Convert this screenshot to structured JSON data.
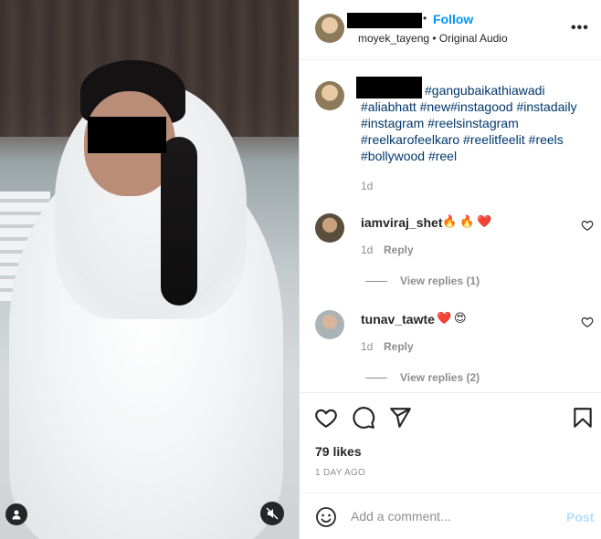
{
  "post": {
    "header": {
      "follow_label": "Follow",
      "dot": "•",
      "subtitle": "moyek_tayeng • Original Audio",
      "more_label": "•••"
    },
    "caption": {
      "text": "#gangubaikathiawadi #aliabhatt #new#instagood #instadaily #instagram #reelsinstagram #reelkarofeelkaro #reelitfeelit #reels #bollywood #reel",
      "age": "1d"
    },
    "comments": [
      {
        "username": "iamviraj_shet",
        "emoji": [
          "🔥",
          "🔥",
          "❤️"
        ],
        "age": "1d",
        "reply_label": "Reply",
        "view_replies_label": "View replies (1)"
      },
      {
        "username": "tunav_tawte",
        "emoji": [
          "❤️",
          "😍"
        ],
        "age": "1d",
        "reply_label": "Reply",
        "view_replies_label": "View replies (2)"
      }
    ],
    "likes_label": "79 likes",
    "date_label": "1 DAY AGO",
    "add_comment": {
      "placeholder": "Add a comment...",
      "post_label": "Post"
    }
  },
  "icons": [
    "user-tag-icon",
    "mute-icon",
    "more-icon",
    "heart-icon",
    "comment-icon",
    "share-icon",
    "bookmark-icon",
    "smile-icon",
    "like-icon"
  ],
  "colors": {
    "link": "#0095f6",
    "hashtag": "#00376b",
    "muted": "#8e8e8e",
    "post_disabled": "#b2dffc"
  }
}
